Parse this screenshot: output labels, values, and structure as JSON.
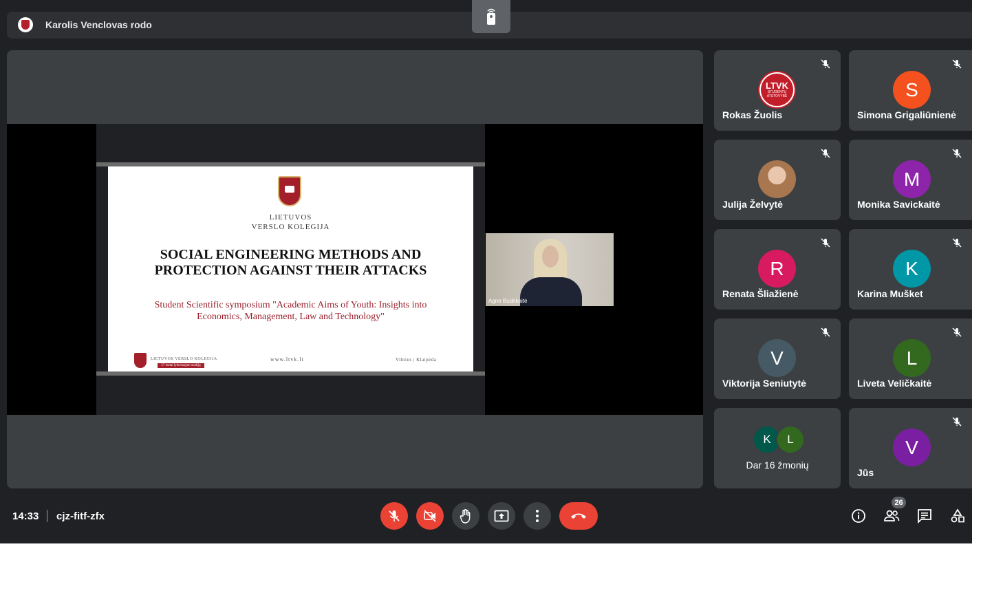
{
  "presenter_bar": {
    "text": "Karolis Venclovas rodo",
    "logo_icon": "ltvk-crest-icon",
    "remote_icon": "remote-control-icon"
  },
  "slide": {
    "org_line1": "LIETUVOS",
    "org_line2": "VERSLO KOLEGIJA",
    "title": "SOCIAL ENGINEERING METHODS AND PROTECTION AGAINST THEIR ATTACKS",
    "subtitle": "Student Scientific symposium \"Academic Aims of Youth: Insights into Economics, Management, Law and Technology\"",
    "footer_org": "LIETUVOS VERSLO KOLEGIJA",
    "footer_ribbon": "27 metai lyderiaujam studijų",
    "footer_url": "www.ltvk.lt",
    "footer_cities": "Vilnius | Klaipėda"
  },
  "speaker": {
    "name": "Agnė Budrikaitė"
  },
  "participants": [
    {
      "name": "Rokas Žuolis",
      "initial": "LTVK",
      "sub": "STUDENTŲ ATSTOVYBĖ",
      "color": "#c21e2a",
      "type": "logo"
    },
    {
      "name": "Simona Grigaliūnienė",
      "initial": "S",
      "color": "#f4511e",
      "type": "letter"
    },
    {
      "name": "Julija Želvytė",
      "initial": "",
      "color": "#a8774f",
      "type": "photo"
    },
    {
      "name": "Monika Savickaitė",
      "initial": "M",
      "color": "#8e24aa",
      "type": "letter"
    },
    {
      "name": "Renata Šliažienė",
      "initial": "R",
      "color": "#d81b60",
      "type": "letter"
    },
    {
      "name": "Karina Mušket",
      "initial": "K",
      "color": "#0097a7",
      "type": "letter"
    },
    {
      "name": "Viktorija Seniutytė",
      "initial": "V",
      "color": "#455a64",
      "type": "letter"
    },
    {
      "name": "Liveta Veličkaitė",
      "initial": "L",
      "color": "#33691e",
      "type": "letter"
    }
  ],
  "more_tile": {
    "avatar1": "K",
    "avatar1_color": "#00584b",
    "avatar2": "L",
    "avatar2_color": "#33691e",
    "text": "Dar 16 žmonių"
  },
  "self_tile": {
    "name": "Jūs",
    "initial": "V",
    "color": "#7b1fa2"
  },
  "bottom_bar": {
    "time": "14:33",
    "meeting_code": "cjz-fitf-zfx",
    "people_count": "26",
    "controls": [
      "mic-off-icon",
      "camera-off-icon",
      "raise-hand-icon",
      "present-screen-icon",
      "more-options-icon",
      "end-call-icon"
    ],
    "right_icons": [
      "info-icon",
      "people-icon",
      "chat-icon",
      "activities-icon"
    ]
  }
}
